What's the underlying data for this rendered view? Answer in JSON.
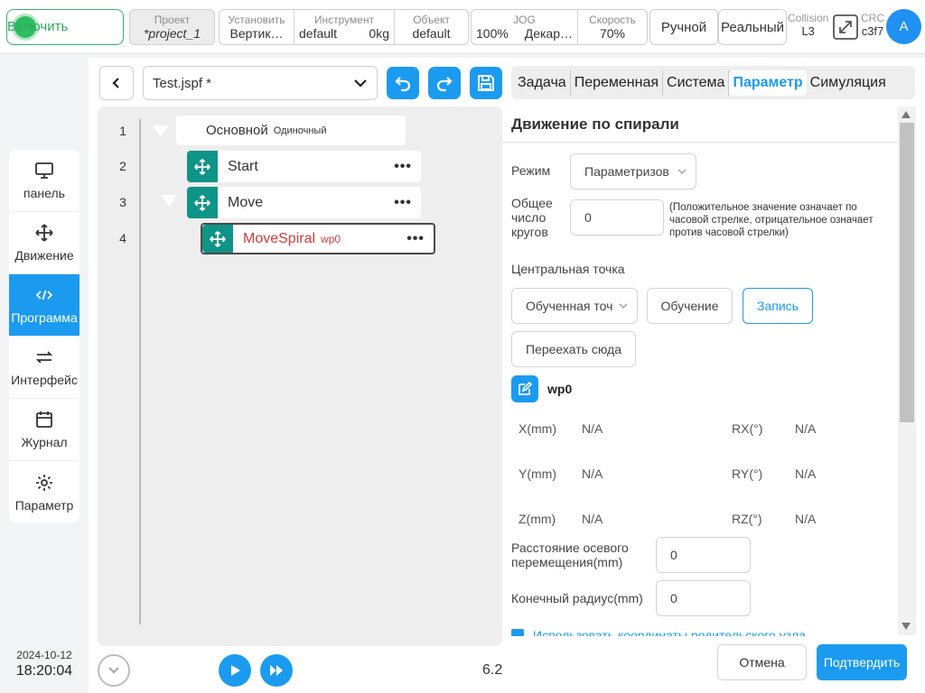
{
  "topbar": {
    "enable_label": "Включить",
    "project": {
      "caption": "Проект",
      "value": "*project_1"
    },
    "install": {
      "caption": "Установить",
      "value": "Вертик…"
    },
    "tool": {
      "caption": "Инструмент",
      "value_a": "default",
      "value_b": "0kg"
    },
    "object": {
      "caption": "Объект",
      "value": "default"
    },
    "jog": {
      "caption": "JOG",
      "value_a": "100%",
      "value_b": "Декар…"
    },
    "speed": {
      "caption": "Скорость",
      "value": "70%"
    },
    "mode_manual": "Ручной",
    "mode_real": "Реальный",
    "collision": {
      "caption": "Collision",
      "value": "L3"
    },
    "crc": {
      "caption": "CRC",
      "value": "c3f7"
    },
    "avatar_letter": "A"
  },
  "sidebar": {
    "items": [
      {
        "label": "панель",
        "icon": "monitor-icon"
      },
      {
        "label": "Движение",
        "icon": "move-icon"
      },
      {
        "label": "Программа",
        "icon": "code-icon"
      },
      {
        "label": "Интерфейс",
        "icon": "swap-icon"
      },
      {
        "label": "Журнал",
        "icon": "calendar-icon"
      },
      {
        "label": "Параметр",
        "icon": "gear-icon"
      }
    ],
    "active_index": 2
  },
  "datetime": {
    "date": "2024-10-12",
    "time": "18:20:04"
  },
  "editor": {
    "file_name": "Test.jspf *",
    "line_numbers": [
      "1",
      "2",
      "3",
      "4"
    ],
    "nodes": {
      "main": {
        "label": "Основной",
        "sub": "Одиночный"
      },
      "start": {
        "label": "Start"
      },
      "move": {
        "label": "Move"
      },
      "movespiral": {
        "label": "MoveSpiral",
        "wp": "wp0"
      }
    },
    "dots": "•••",
    "version": "6.2"
  },
  "tabs": [
    "Задача",
    "Переменная",
    "Система",
    "Параметр",
    "Симуляция"
  ],
  "tab_active": 3,
  "param": {
    "title": "Движение по спирали",
    "mode_label": "Режим",
    "mode_value": "Параметризов",
    "circles_label": "Общее число кругов",
    "circles_value": "0",
    "circles_note": "(Положительное значение означает по часовой стрелке, отрицательное означает против часовой стрелки)",
    "center_label": "Центральная точка",
    "center_select": "Обученная точ",
    "teach_button": "Обучение",
    "record_button": "Запись",
    "move_here_button": "Переехать сюда",
    "waypoint": "wp0",
    "coords": [
      {
        "label": "X(mm)",
        "value": "N/A"
      },
      {
        "label": "RX(°)",
        "value": "N/A"
      },
      {
        "label": "Y(mm)",
        "value": "N/A"
      },
      {
        "label": "RY(°)",
        "value": "N/A"
      },
      {
        "label": "Z(mm)",
        "value": "N/A"
      },
      {
        "label": "RZ(°)",
        "value": "N/A"
      }
    ],
    "axial_label": "Расстояние осевого перемещения(mm)",
    "axial_value": "0",
    "radius_label": "Конечный радиус(mm)",
    "radius_value": "0",
    "cutoff_text": "Использовать координаты родительского узла"
  },
  "footer": {
    "cancel": "Отмена",
    "confirm": "Подтвердить"
  },
  "colors": {
    "accent": "#1b9bf0",
    "teal": "#0f9488",
    "green": "#2ebd5f",
    "red": "#d03b3b"
  }
}
